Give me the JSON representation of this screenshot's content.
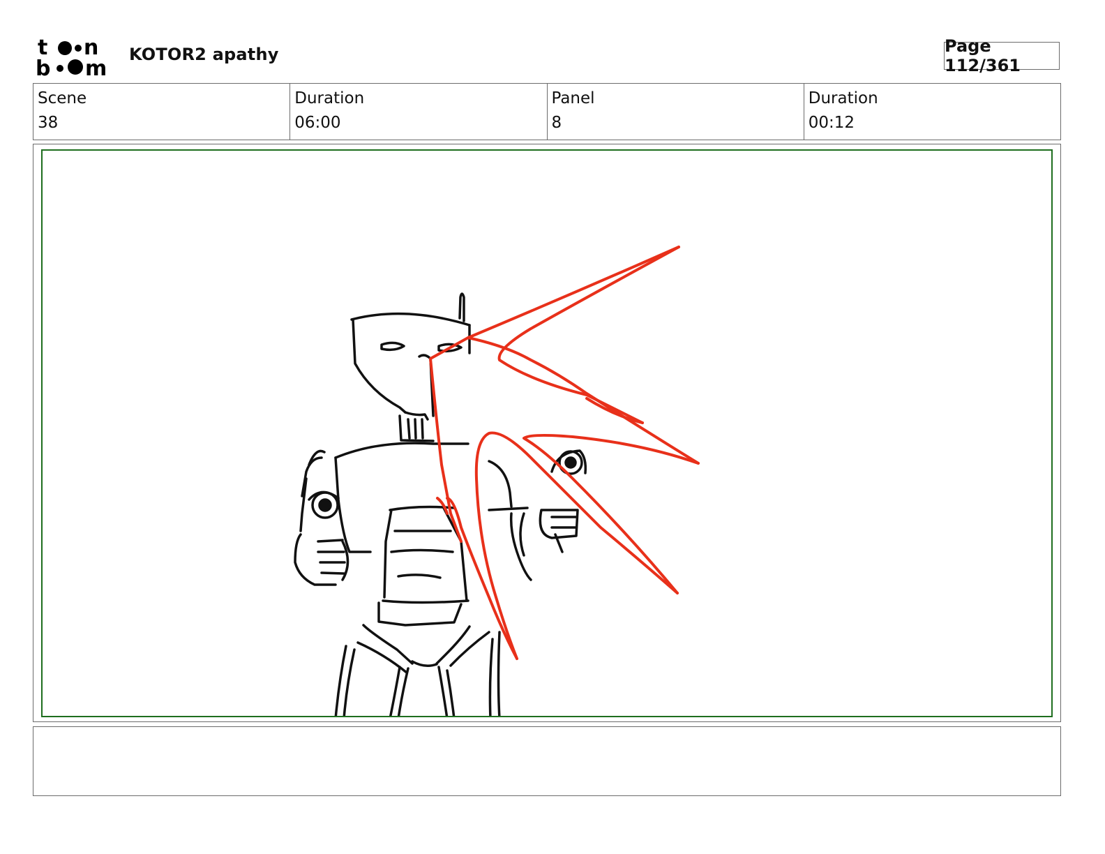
{
  "header": {
    "logo_text": "toon boom",
    "project_title": "KOTOR2 apathy",
    "page_indicator": "Page 112/361"
  },
  "info": {
    "scene_label": "Scene",
    "scene_value": "38",
    "scene_duration_label": "Duration",
    "scene_duration_value": "06:00",
    "panel_label": "Panel",
    "panel_value": "8",
    "panel_duration_label": "Duration",
    "panel_duration_value": "00:12"
  },
  "panel": {
    "sketch": "robot-droid-sketch",
    "annotation": "red-arrow-annotation",
    "annotation_color": "#e8301a",
    "safe_frame_color": "#1e6e1e"
  },
  "notes": {
    "text": ""
  }
}
